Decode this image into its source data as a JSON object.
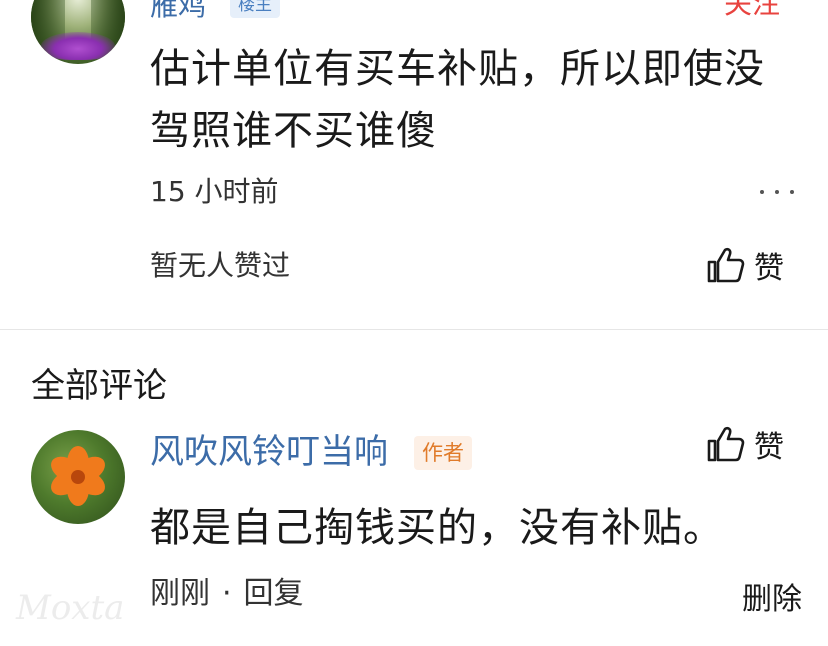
{
  "top_post": {
    "username": "雁鸡",
    "op_badge": "楼主",
    "follow_label": "关注",
    "text": "估计单位有买车补贴，所以即使没驾照谁不买谁傻",
    "time": "15 小时前",
    "likes_text": "暂无人赞过",
    "like_label": "赞"
  },
  "comments_section": {
    "title": "全部评论"
  },
  "comment": {
    "username": "风吹风铃叮当响",
    "author_badge": "作者",
    "text": "都是自己掏钱买的，没有补贴。",
    "time": "刚刚",
    "separator": "·",
    "reply_label": "回复",
    "delete_label": "删除",
    "like_label": "赞"
  },
  "icons": {
    "more": "more-horizontal-icon",
    "like": "thumbs-up-icon"
  },
  "colors": {
    "username": "#3c6ca8",
    "follow": "#e8433f",
    "author_badge_bg": "#fdf0e6",
    "author_badge_text": "#e07b2a",
    "op_badge_bg": "#e6effa",
    "op_badge_text": "#4a7fc0"
  },
  "watermark": "Moxta"
}
